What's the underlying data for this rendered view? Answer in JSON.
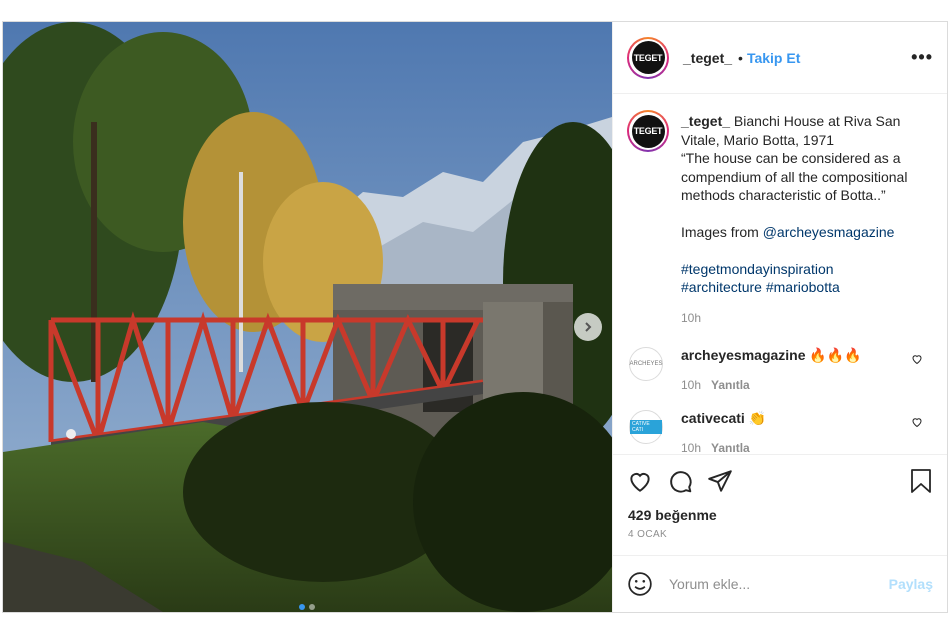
{
  "post": {
    "username": "_teget_",
    "avatar_text": "TEGET",
    "separator": "•",
    "follow_label": "Takip Et",
    "more_label": "•••",
    "caption": {
      "username": "_teget_",
      "text": " Bianchi House at Riva San\nVitale, Mario Botta, 1971\n“The house can be considered as a\ncompendium of all the compositional\nmethods characteristic of Botta..”\n\nImages from ",
      "mention": "@archeyesmagazine",
      "hashtags_line1": "#tegetmondayinspiration",
      "hashtags_line2_a": "#architecture",
      "hashtags_line2_b": "#mariobotta",
      "time": "10h"
    },
    "comments": [
      {
        "username": "archeyesmagazine",
        "text": "🔥🔥🔥",
        "avatar_text": "ARCHEYES",
        "time": "10h",
        "reply": "Yanıtla"
      },
      {
        "username": "cativecati",
        "text": "👏",
        "avatar_text": "CATIVE CATI",
        "time": "10h",
        "reply": "Yanıtla"
      }
    ],
    "likes": "429 beğenme",
    "date": "4 OCAK",
    "comment_placeholder": "Yorum ekle...",
    "share_label": "Paylaş",
    "colors": {
      "accent": "#3897f0",
      "bridge": "#c8392b",
      "sky": "#6b8fb8"
    }
  }
}
